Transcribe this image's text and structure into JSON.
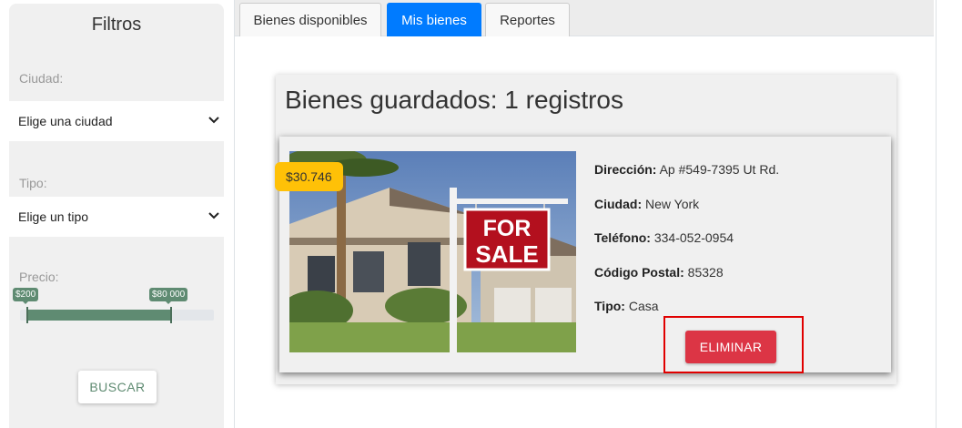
{
  "sidebar": {
    "title": "Filtros",
    "city_label": "Ciudad:",
    "city_select": "Elige una ciudad",
    "type_label": "Tipo:",
    "type_select": "Elige un tipo",
    "price_label": "Precio:",
    "price_min": "$200",
    "price_max": "$80 000",
    "search_button": "BUSCAR"
  },
  "tabs": [
    {
      "label": "Bienes disponibles",
      "active": false
    },
    {
      "label": "Mis bienes",
      "active": true
    },
    {
      "label": "Reportes",
      "active": false
    }
  ],
  "panel": {
    "title": "Bienes guardados: 1 registros"
  },
  "property": {
    "price": "$30.746",
    "image_sign_top": "FOR",
    "image_sign_bottom": "SALE",
    "rows": [
      {
        "label": "Dirección:",
        "value": "Ap #549-7395 Ut Rd."
      },
      {
        "label": "Ciudad:",
        "value": "New York"
      },
      {
        "label": "Teléfono:",
        "value": "334-052-0954"
      },
      {
        "label": "Código Postal:",
        "value": "85328"
      },
      {
        "label": "Tipo:",
        "value": "Casa"
      }
    ],
    "delete_button": "ELIMINAR"
  },
  "colors": {
    "active_tab": "#007bff",
    "slider": "#5f8b72",
    "price_badge": "#ffc107",
    "delete_button": "#dc3545",
    "highlight": "#e00000"
  }
}
